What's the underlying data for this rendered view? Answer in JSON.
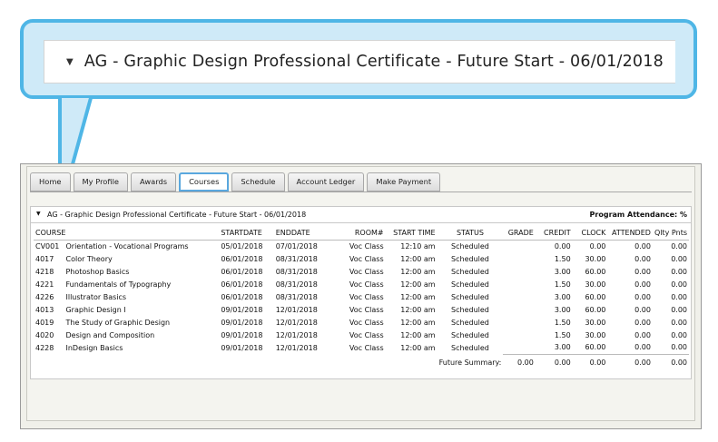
{
  "callout": {
    "program_title": "AG - Graphic Design Professional Certificate - Future Start - 06/01/2018"
  },
  "tabs": [
    {
      "label": "Home"
    },
    {
      "label": "My Profile"
    },
    {
      "label": "Awards"
    },
    {
      "label": "Courses"
    },
    {
      "label": "Schedule"
    },
    {
      "label": "Account Ledger"
    },
    {
      "label": "Make Payment"
    }
  ],
  "active_tab": "Courses",
  "panel": {
    "program_title": "AG - Graphic Design Professional Certificate - Future Start - 06/01/2018",
    "attendance_label": "Program Attendance: %"
  },
  "table": {
    "headers": {
      "course": "COURSE",
      "startdate": "STARTDATE",
      "enddate": "ENDDATE",
      "room": "ROOM#",
      "start_time": "START TIME",
      "status": "STATUS",
      "grade": "GRADE",
      "credit": "CREDIT",
      "clock": "CLOCK",
      "attended": "ATTENDED",
      "qty_pnts": "Qlty Pnts"
    },
    "rows": [
      {
        "code": "CV001",
        "name": "Orientation - Vocational Programs",
        "start": "05/01/2018",
        "end": "07/01/2018",
        "room": "Voc Class",
        "time": "12:10 am",
        "status": "Scheduled",
        "grade": "",
        "credit": "0.00",
        "clock": "0.00",
        "attended": "0.00",
        "qty": "0.00"
      },
      {
        "code": "4017",
        "name": "Color Theory",
        "start": "06/01/2018",
        "end": "08/31/2018",
        "room": "Voc Class",
        "time": "12:00 am",
        "status": "Scheduled",
        "grade": "",
        "credit": "1.50",
        "clock": "30.00",
        "attended": "0.00",
        "qty": "0.00"
      },
      {
        "code": "4218",
        "name": "Photoshop Basics",
        "start": "06/01/2018",
        "end": "08/31/2018",
        "room": "Voc Class",
        "time": "12:00 am",
        "status": "Scheduled",
        "grade": "",
        "credit": "3.00",
        "clock": "60.00",
        "attended": "0.00",
        "qty": "0.00"
      },
      {
        "code": "4221",
        "name": "Fundamentals of Typography",
        "start": "06/01/2018",
        "end": "08/31/2018",
        "room": "Voc Class",
        "time": "12:00 am",
        "status": "Scheduled",
        "grade": "",
        "credit": "1.50",
        "clock": "30.00",
        "attended": "0.00",
        "qty": "0.00"
      },
      {
        "code": "4226",
        "name": "Illustrator Basics",
        "start": "06/01/2018",
        "end": "08/31/2018",
        "room": "Voc Class",
        "time": "12:00 am",
        "status": "Scheduled",
        "grade": "",
        "credit": "3.00",
        "clock": "60.00",
        "attended": "0.00",
        "qty": "0.00"
      },
      {
        "code": "4013",
        "name": "Graphic Design I",
        "start": "09/01/2018",
        "end": "12/01/2018",
        "room": "Voc Class",
        "time": "12:00 am",
        "status": "Scheduled",
        "grade": "",
        "credit": "3.00",
        "clock": "60.00",
        "attended": "0.00",
        "qty": "0.00"
      },
      {
        "code": "4019",
        "name": "The Study of Graphic Design",
        "start": "09/01/2018",
        "end": "12/01/2018",
        "room": "Voc Class",
        "time": "12:00 am",
        "status": "Scheduled",
        "grade": "",
        "credit": "1.50",
        "clock": "30.00",
        "attended": "0.00",
        "qty": "0.00"
      },
      {
        "code": "4020",
        "name": "Design and Composition",
        "start": "09/01/2018",
        "end": "12/01/2018",
        "room": "Voc Class",
        "time": "12:00 am",
        "status": "Scheduled",
        "grade": "",
        "credit": "1.50",
        "clock": "30.00",
        "attended": "0.00",
        "qty": "0.00"
      },
      {
        "code": "4228",
        "name": "InDesign Basics",
        "start": "09/01/2018",
        "end": "12/01/2018",
        "room": "Voc Class",
        "time": "12:00 am",
        "status": "Scheduled",
        "grade": "",
        "credit": "3.00",
        "clock": "60.00",
        "attended": "0.00",
        "qty": "0.00"
      }
    ],
    "summary": {
      "label": "Future Summary:",
      "grade": "0.00",
      "credit": "0.00",
      "clock": "0.00",
      "attended": "0.00",
      "qty": "0.00"
    }
  },
  "colors": {
    "callout_border": "#4fb6e6",
    "callout_fill": "#cfeaf8",
    "active_tab_border": "#5aa7de"
  },
  "icons": {
    "expand": "triangle-down-icon"
  }
}
